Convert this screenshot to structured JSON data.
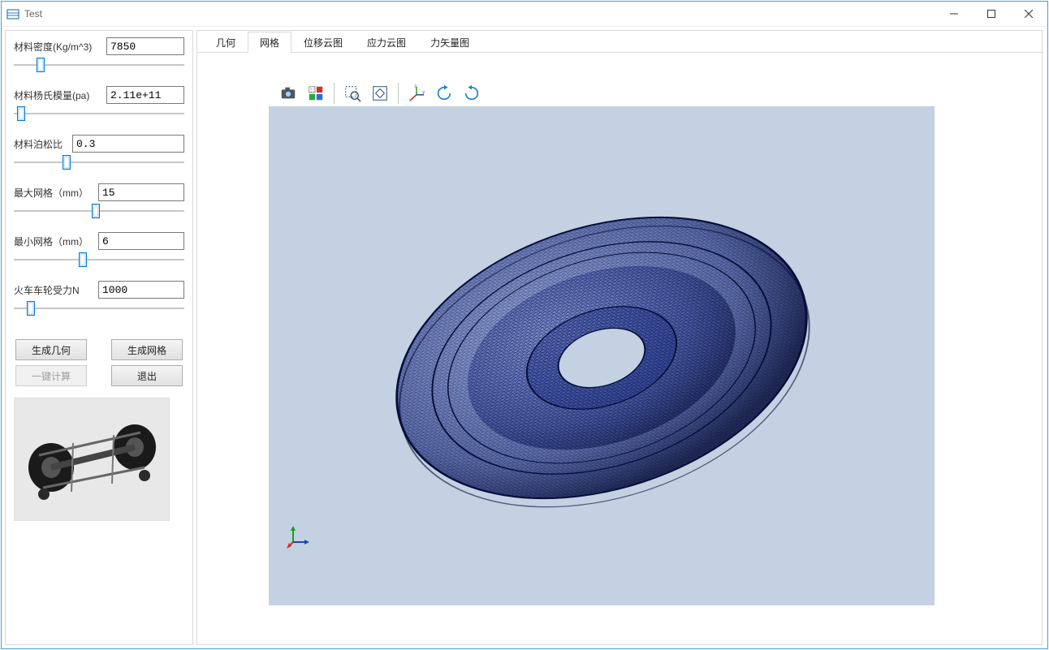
{
  "window": {
    "title": "Test"
  },
  "params": {
    "density": {
      "label": "材料密度(Kg/m^3)",
      "value": "7850",
      "slider_pct": 14
    },
    "young": {
      "label": "材料杨氏模量(pa)",
      "value": "2.11e+11",
      "slider_pct": 2
    },
    "poisson": {
      "label": "材料泊松比",
      "value": "0.3",
      "slider_pct": 30
    },
    "max_mesh": {
      "label": "最大网格（mm）",
      "value": "15",
      "slider_pct": 48
    },
    "min_mesh": {
      "label": "最小网格（mm）",
      "value": "6",
      "slider_pct": 40
    },
    "force": {
      "label": "火车车轮受力N",
      "value": "1000",
      "slider_pct": 8
    }
  },
  "buttons": {
    "gen_geom": "生成几何",
    "gen_mesh": "生成网格",
    "one_click": "一键计算",
    "exit": "退出"
  },
  "tabs": [
    {
      "id": "geom",
      "label": "几何",
      "active": false
    },
    {
      "id": "mesh",
      "label": "网格",
      "active": true
    },
    {
      "id": "disp",
      "label": "位移云图",
      "active": false
    },
    {
      "id": "stress",
      "label": "应力云图",
      "active": false
    },
    {
      "id": "force",
      "label": "力矢量图",
      "active": false
    }
  ],
  "toolbar": {
    "snapshot": "snapshot",
    "colormap": "colormap",
    "zoom_area": "zoom-area",
    "fit": "fit-view",
    "xyz": "xyz-orient",
    "rotate_left": "rotate-left",
    "rotate_right": "rotate-right"
  }
}
